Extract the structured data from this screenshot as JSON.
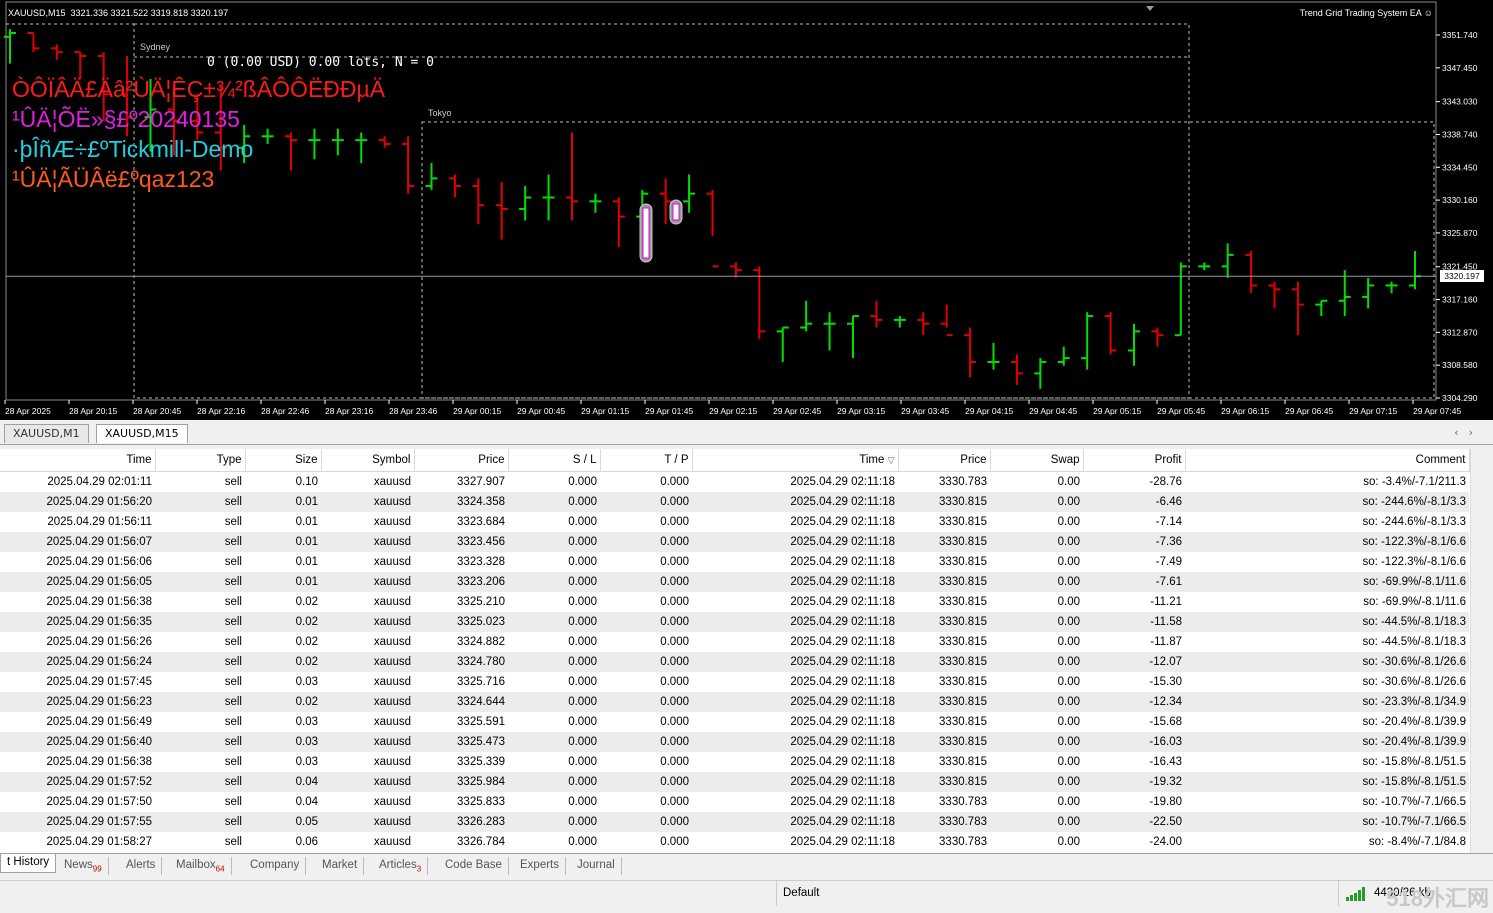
{
  "chart": {
    "title": "XAUUSD,M15  3321.336 3321.522 3319.818 3320.197",
    "ea_name": "Trend Grid Trading System EA ☺",
    "lots_text": "0 (0.00 USD) 0.00 lots, N = 0",
    "overlay_lines": [
      {
        "text": "ÒÔÏÂÄ£Äâ²ÙÄ¦ÊÇ±¾²ßÂÔÔËÐÐµÄ",
        "color": "#ff1a1a"
      },
      {
        "text": "¹ÛÄ¦ÕË»§£º20240135",
        "color": "#e020e0"
      },
      {
        "text": "·þÎñÆ÷£ºTickmill-Demo",
        "color": "#20d0e0"
      },
      {
        "text": "¹ÛÄ¦ÃÜÂë£ºqaz123",
        "color": "#ff5a1a"
      }
    ],
    "sessions": [
      "Sydney",
      "Tokyo"
    ],
    "current_price": "3320.197",
    "price_axis": [
      "3351.740",
      "3347.450",
      "3343.030",
      "3338.740",
      "3334.450",
      "3330.160",
      "3325.870",
      "3321.450",
      "3317.160",
      "3312.870",
      "3308.580",
      "3304.290"
    ],
    "time_axis": [
      "28 Apr 2025",
      "28 Apr 20:15",
      "28 Apr 20:45",
      "28 Apr 22:16",
      "28 Apr 22:46",
      "28 Apr 23:16",
      "28 Apr 23:46",
      "29 Apr 00:15",
      "29 Apr 00:45",
      "29 Apr 01:15",
      "29 Apr 01:45",
      "29 Apr 02:15",
      "29 Apr 02:45",
      "29 Apr 03:15",
      "29 Apr 03:45",
      "29 Apr 04:15",
      "29 Apr 04:45",
      "29 Apr 05:15",
      "29 Apr 05:45",
      "29 Apr 06:15",
      "29 Apr 06:45",
      "29 Apr 07:15",
      "29 Apr 07:45"
    ],
    "colors": {
      "bull": "#00e000",
      "bear": "#e00000",
      "background": "#000000"
    },
    "bars": [
      {
        "o": 3351.5,
        "h": 3352.5,
        "l": 3348.0,
        "c": 3352.0
      },
      {
        "o": 3352.0,
        "h": 3352.0,
        "l": 3349.5,
        "c": 3350.0
      },
      {
        "o": 3350.0,
        "h": 3350.5,
        "l": 3348.5,
        "c": 3349.5
      },
      {
        "o": 3349.5,
        "h": 3349.5,
        "l": 3346.0,
        "c": 3349.0
      },
      {
        "o": 3349.0,
        "h": 3349.5,
        "l": 3340.5,
        "c": 3344.0
      },
      {
        "o": 3344.0,
        "h": 3349.0,
        "l": 3338.5,
        "c": 3341.0
      },
      {
        "o": 3341.0,
        "h": 3346.0,
        "l": 3336.5,
        "c": 3342.0
      },
      {
        "o": 3342.0,
        "h": 3345.0,
        "l": 3336.0,
        "c": 3340.5
      },
      {
        "o": 3340.5,
        "h": 3344.0,
        "l": 3338.0,
        "c": 3339.0
      },
      {
        "o": 3339.0,
        "h": 3345.0,
        "l": 3334.0,
        "c": 3337.0
      },
      {
        "o": 3337.0,
        "h": 3340.0,
        "l": 3335.0,
        "c": 3338.5
      },
      {
        "o": 3338.5,
        "h": 3339.5,
        "l": 3337.5,
        "c": 3338.5
      },
      {
        "o": 3338.5,
        "h": 3339.0,
        "l": 3334.0,
        "c": 3338.0
      },
      {
        "o": 3338.0,
        "h": 3339.5,
        "l": 3335.5,
        "c": 3338.0
      },
      {
        "o": 3338.0,
        "h": 3339.5,
        "l": 3336.0,
        "c": 3338.0
      },
      {
        "o": 3338.0,
        "h": 3339.0,
        "l": 3335.0,
        "c": 3338.0
      },
      {
        "o": 3338.0,
        "h": 3338.5,
        "l": 3337.0,
        "c": 3337.5
      },
      {
        "o": 3337.5,
        "h": 3338.5,
        "l": 3331.0,
        "c": 3332.0
      },
      {
        "o": 3332.0,
        "h": 3335.0,
        "l": 3331.5,
        "c": 3333.0
      },
      {
        "o": 3333.0,
        "h": 3333.5,
        "l": 3330.5,
        "c": 3332.0
      },
      {
        "o": 3332.0,
        "h": 3333.0,
        "l": 3327.0,
        "c": 3329.5
      },
      {
        "o": 3329.5,
        "h": 3332.5,
        "l": 3325.0,
        "c": 3329.0
      },
      {
        "o": 3329.0,
        "h": 3332.0,
        "l": 3327.5,
        "c": 3330.5
      },
      {
        "o": 3330.5,
        "h": 3333.5,
        "l": 3327.5,
        "c": 3330.5
      },
      {
        "o": 3330.5,
        "h": 3339.0,
        "l": 3327.5,
        "c": 3330.0
      },
      {
        "o": 3330.0,
        "h": 3331.0,
        "l": 3328.5,
        "c": 3330.0
      },
      {
        "o": 3330.0,
        "h": 3330.5,
        "l": 3324.0,
        "c": 3328.0
      },
      {
        "o": 3328.0,
        "h": 3331.5,
        "l": 3327.0,
        "c": 3331.0
      },
      {
        "o": 3331.0,
        "h": 3333.0,
        "l": 3327.0,
        "c": 3330.0
      },
      {
        "o": 3330.0,
        "h": 3333.5,
        "l": 3328.5,
        "c": 3331.0
      },
      {
        "o": 3331.0,
        "h": 3331.5,
        "l": 3325.5,
        "c": 3321.5
      },
      {
        "o": 3321.5,
        "h": 3322.0,
        "l": 3320.0,
        "c": 3321.0
      },
      {
        "o": 3321.0,
        "h": 3321.5,
        "l": 3312.0,
        "c": 3313.0
      },
      {
        "o": 3313.0,
        "h": 3313.5,
        "l": 3309.0,
        "c": 3313.5
      },
      {
        "o": 3313.5,
        "h": 3317.0,
        "l": 3313.0,
        "c": 3314.0
      },
      {
        "o": 3314.0,
        "h": 3315.5,
        "l": 3310.5,
        "c": 3314.0
      },
      {
        "o": 3314.0,
        "h": 3315.0,
        "l": 3309.5,
        "c": 3315.0
      },
      {
        "o": 3315.0,
        "h": 3317.0,
        "l": 3313.5,
        "c": 3314.5
      },
      {
        "o": 3314.5,
        "h": 3315.0,
        "l": 3313.5,
        "c": 3314.5
      },
      {
        "o": 3314.5,
        "h": 3315.5,
        "l": 3312.5,
        "c": 3314.0
      },
      {
        "o": 3314.0,
        "h": 3316.5,
        "l": 3313.5,
        "c": 3312.5
      },
      {
        "o": 3312.5,
        "h": 3313.5,
        "l": 3307.0,
        "c": 3309.0
      },
      {
        "o": 3309.0,
        "h": 3311.5,
        "l": 3308.0,
        "c": 3309.0
      },
      {
        "o": 3309.0,
        "h": 3310.0,
        "l": 3306.0,
        "c": 3307.5
      },
      {
        "o": 3307.5,
        "h": 3309.5,
        "l": 3305.5,
        "c": 3309.0
      },
      {
        "o": 3309.0,
        "h": 3311.0,
        "l": 3308.5,
        "c": 3309.5
      },
      {
        "o": 3309.5,
        "h": 3315.5,
        "l": 3308.0,
        "c": 3315.0
      },
      {
        "o": 3315.0,
        "h": 3315.5,
        "l": 3310.0,
        "c": 3310.5
      },
      {
        "o": 3310.5,
        "h": 3314.0,
        "l": 3308.5,
        "c": 3313.0
      },
      {
        "o": 3313.0,
        "h": 3313.5,
        "l": 3311.0,
        "c": 3312.5
      },
      {
        "o": 3312.5,
        "h": 3322.0,
        "l": 3312.5,
        "c": 3321.5
      },
      {
        "o": 3321.5,
        "h": 3322.0,
        "l": 3321.0,
        "c": 3321.5
      },
      {
        "o": 3321.5,
        "h": 3324.5,
        "l": 3320.0,
        "c": 3323.0
      },
      {
        "o": 3323.0,
        "h": 3323.5,
        "l": 3318.0,
        "c": 3319.0
      },
      {
        "o": 3319.0,
        "h": 3319.5,
        "l": 3316.0,
        "c": 3318.5
      },
      {
        "o": 3318.5,
        "h": 3319.5,
        "l": 3312.5,
        "c": 3316.5
      },
      {
        "o": 3316.5,
        "h": 3317.0,
        "l": 3315.0,
        "c": 3317.0
      },
      {
        "o": 3317.0,
        "h": 3321.0,
        "l": 3315.0,
        "c": 3317.5
      },
      {
        "o": 3317.5,
        "h": 3320.0,
        "l": 3316.0,
        "c": 3319.0
      },
      {
        "o": 3319.0,
        "h": 3319.5,
        "l": 3318.0,
        "c": 3319.0
      },
      {
        "o": 3319.0,
        "h": 3323.5,
        "l": 3318.5,
        "c": 3320.2
      }
    ]
  },
  "chart_tabs": [
    "XAUUSD,M1",
    "XAUUSD,M15"
  ],
  "table": {
    "headers": [
      "Time",
      "Type",
      "Size",
      "Symbol",
      "Price",
      "S / L",
      "T / P",
      "Time",
      "Price",
      "Swap",
      "Profit",
      "Comment"
    ],
    "sort_marker": "▽",
    "rows": [
      [
        "2025.04.29 02:01:11",
        "sell",
        "0.10",
        "xauusd",
        "3327.907",
        "0.000",
        "0.000",
        "2025.04.29 02:11:18",
        "3330.783",
        "0.00",
        "-28.76",
        "so: -3.4%/-7.1/211.3"
      ],
      [
        "2025.04.29 01:56:20",
        "sell",
        "0.01",
        "xauusd",
        "3324.358",
        "0.000",
        "0.000",
        "2025.04.29 02:11:18",
        "3330.815",
        "0.00",
        "-6.46",
        "so: -244.6%/-8.1/3.3"
      ],
      [
        "2025.04.29 01:56:11",
        "sell",
        "0.01",
        "xauusd",
        "3323.684",
        "0.000",
        "0.000",
        "2025.04.29 02:11:18",
        "3330.815",
        "0.00",
        "-7.14",
        "so: -244.6%/-8.1/3.3"
      ],
      [
        "2025.04.29 01:56:07",
        "sell",
        "0.01",
        "xauusd",
        "3323.456",
        "0.000",
        "0.000",
        "2025.04.29 02:11:18",
        "3330.815",
        "0.00",
        "-7.36",
        "so: -122.3%/-8.1/6.6"
      ],
      [
        "2025.04.29 01:56:06",
        "sell",
        "0.01",
        "xauusd",
        "3323.328",
        "0.000",
        "0.000",
        "2025.04.29 02:11:18",
        "3330.815",
        "0.00",
        "-7.49",
        "so: -122.3%/-8.1/6.6"
      ],
      [
        "2025.04.29 01:56:05",
        "sell",
        "0.01",
        "xauusd",
        "3323.206",
        "0.000",
        "0.000",
        "2025.04.29 02:11:18",
        "3330.815",
        "0.00",
        "-7.61",
        "so: -69.9%/-8.1/11.6"
      ],
      [
        "2025.04.29 01:56:38",
        "sell",
        "0.02",
        "xauusd",
        "3325.210",
        "0.000",
        "0.000",
        "2025.04.29 02:11:18",
        "3330.815",
        "0.00",
        "-11.21",
        "so: -69.9%/-8.1/11.6"
      ],
      [
        "2025.04.29 01:56:35",
        "sell",
        "0.02",
        "xauusd",
        "3325.023",
        "0.000",
        "0.000",
        "2025.04.29 02:11:18",
        "3330.815",
        "0.00",
        "-11.58",
        "so: -44.5%/-8.1/18.3"
      ],
      [
        "2025.04.29 01:56:26",
        "sell",
        "0.02",
        "xauusd",
        "3324.882",
        "0.000",
        "0.000",
        "2025.04.29 02:11:18",
        "3330.815",
        "0.00",
        "-11.87",
        "so: -44.5%/-8.1/18.3"
      ],
      [
        "2025.04.29 01:56:24",
        "sell",
        "0.02",
        "xauusd",
        "3324.780",
        "0.000",
        "0.000",
        "2025.04.29 02:11:18",
        "3330.815",
        "0.00",
        "-12.07",
        "so: -30.6%/-8.1/26.6"
      ],
      [
        "2025.04.29 01:57:45",
        "sell",
        "0.03",
        "xauusd",
        "3325.716",
        "0.000",
        "0.000",
        "2025.04.29 02:11:18",
        "3330.815",
        "0.00",
        "-15.30",
        "so: -30.6%/-8.1/26.6"
      ],
      [
        "2025.04.29 01:56:23",
        "sell",
        "0.02",
        "xauusd",
        "3324.644",
        "0.000",
        "0.000",
        "2025.04.29 02:11:18",
        "3330.815",
        "0.00",
        "-12.34",
        "so: -23.3%/-8.1/34.9"
      ],
      [
        "2025.04.29 01:56:49",
        "sell",
        "0.03",
        "xauusd",
        "3325.591",
        "0.000",
        "0.000",
        "2025.04.29 02:11:18",
        "3330.815",
        "0.00",
        "-15.68",
        "so: -20.4%/-8.1/39.9"
      ],
      [
        "2025.04.29 01:56:40",
        "sell",
        "0.03",
        "xauusd",
        "3325.473",
        "0.000",
        "0.000",
        "2025.04.29 02:11:18",
        "3330.815",
        "0.00",
        "-16.03",
        "so: -20.4%/-8.1/39.9"
      ],
      [
        "2025.04.29 01:56:38",
        "sell",
        "0.03",
        "xauusd",
        "3325.339",
        "0.000",
        "0.000",
        "2025.04.29 02:11:18",
        "3330.815",
        "0.00",
        "-16.43",
        "so: -15.8%/-8.1/51.5"
      ],
      [
        "2025.04.29 01:57:52",
        "sell",
        "0.04",
        "xauusd",
        "3325.984",
        "0.000",
        "0.000",
        "2025.04.29 02:11:18",
        "3330.815",
        "0.00",
        "-19.32",
        "so: -15.8%/-8.1/51.5"
      ],
      [
        "2025.04.29 01:57:50",
        "sell",
        "0.04",
        "xauusd",
        "3325.833",
        "0.000",
        "0.000",
        "2025.04.29 02:11:18",
        "3330.783",
        "0.00",
        "-19.80",
        "so: -10.7%/-7.1/66.5"
      ],
      [
        "2025.04.29 01:57:55",
        "sell",
        "0.05",
        "xauusd",
        "3326.283",
        "0.000",
        "0.000",
        "2025.04.29 02:11:18",
        "3330.783",
        "0.00",
        "-22.50",
        "so: -10.7%/-7.1/66.5"
      ],
      [
        "2025.04.29 01:58:27",
        "sell",
        "0.06",
        "xauusd",
        "3326.784",
        "0.000",
        "0.000",
        "2025.04.29 02:11:18",
        "3330.783",
        "0.00",
        "-24.00",
        "so: -8.4%/-7.1/84.8"
      ]
    ]
  },
  "bottom_tabs": [
    {
      "label": "t History",
      "badge": ""
    },
    {
      "label": "News",
      "badge": "99"
    },
    {
      "label": "Alerts",
      "badge": ""
    },
    {
      "label": "Mailbox",
      "badge": "64"
    },
    {
      "label": "Company",
      "badge": ""
    },
    {
      "label": "Market",
      "badge": ""
    },
    {
      "label": "Articles",
      "badge": "3"
    },
    {
      "label": "Code Base",
      "badge": ""
    },
    {
      "label": "Experts",
      "badge": ""
    },
    {
      "label": "Journal",
      "badge": ""
    }
  ],
  "status": {
    "profile": "Default",
    "traffic": "4430/26 kb",
    "watermark": "518外汇网"
  }
}
